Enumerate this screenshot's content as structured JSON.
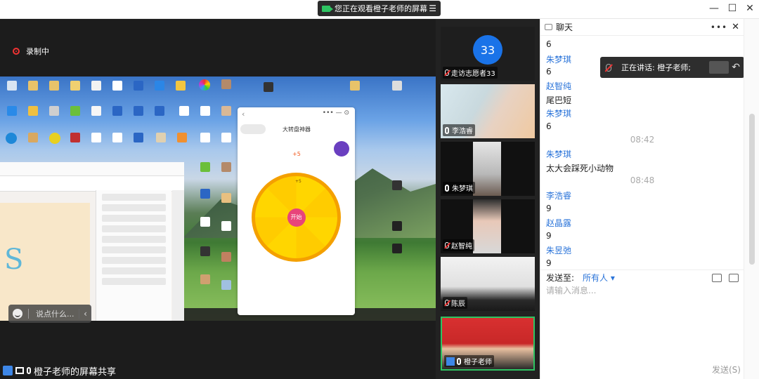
{
  "top_bar": {
    "share_notice": "您正在观看橙子老师的屏幕",
    "list_icon": "list-icon"
  },
  "window": {
    "minimize": "—",
    "maximize": "☐",
    "close": "✕"
  },
  "recording": {
    "label": "录制中"
  },
  "shared_screen": {
    "phone_app": {
      "title": "大转盘神器",
      "bonus": "+5",
      "start_button": "开始",
      "top_slot": "+5"
    },
    "mini_chat": {
      "placeholder": "说点什么..."
    }
  },
  "share_label": "橙子老师的屏幕共享",
  "participants": [
    {
      "name": "走访志愿者33",
      "avatar_text": "33",
      "muted": true
    },
    {
      "name": "李浩睿",
      "muted": false
    },
    {
      "name": "朱梦琪",
      "muted": false
    },
    {
      "name": "赵智纯",
      "muted": true
    },
    {
      "name": "陈辰",
      "muted": true
    },
    {
      "name": "橙子老师",
      "muted": false
    }
  ],
  "chat": {
    "title": "聊天",
    "speaking_now": "正在讲话: 橙子老师;",
    "messages": [
      {
        "sender": "",
        "text": "6"
      },
      {
        "sender": "朱梦琪",
        "text": "6"
      },
      {
        "sender": "赵智纯",
        "text": "尾巴短"
      },
      {
        "sender": "朱梦琪",
        "text": "6"
      },
      {
        "time": "08:42"
      },
      {
        "sender": "朱梦琪",
        "text": "太大会踩死小动物"
      },
      {
        "time": "08:48"
      },
      {
        "sender": "李浩睿",
        "text": "9"
      },
      {
        "sender": "赵晶露",
        "text": "9"
      },
      {
        "sender": "朱昱弛",
        "text": "9"
      }
    ],
    "send_to_label": "发送至:",
    "send_to_value": "所有人",
    "input_placeholder": "请输入消息...",
    "send_button": "发送(S)"
  },
  "colors": {
    "accent": "#2b74d9",
    "recording": "#e33333",
    "avatar": "#1a73e8"
  }
}
